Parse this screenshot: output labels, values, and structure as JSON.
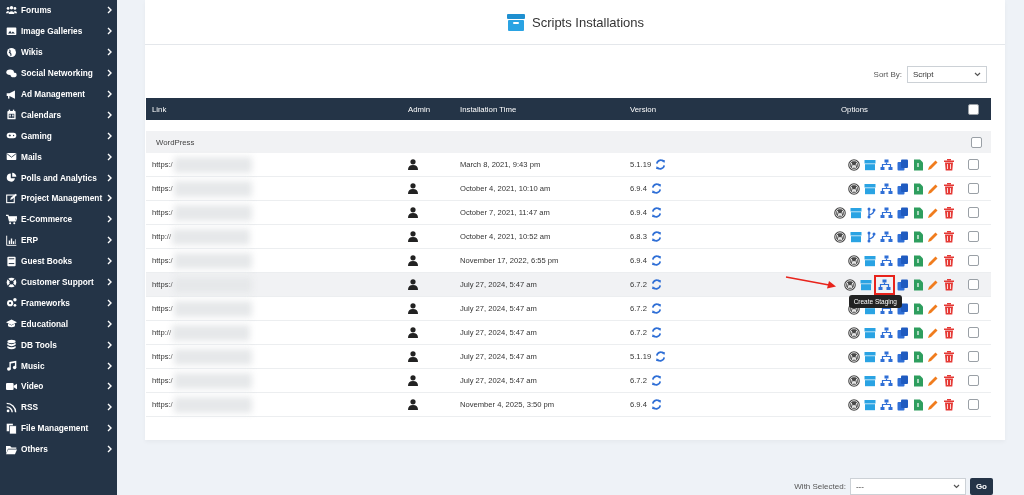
{
  "sidebar": {
    "items": [
      {
        "label": "Forums"
      },
      {
        "label": "Image Galleries"
      },
      {
        "label": "Wikis"
      },
      {
        "label": "Social Networking"
      },
      {
        "label": "Ad Management"
      },
      {
        "label": "Calendars"
      },
      {
        "label": "Gaming"
      },
      {
        "label": "Mails"
      },
      {
        "label": "Polls and Analytics"
      },
      {
        "label": "Project Management"
      },
      {
        "label": "E-Commerce"
      },
      {
        "label": "ERP"
      },
      {
        "label": "Guest Books"
      },
      {
        "label": "Customer Support"
      },
      {
        "label": "Frameworks"
      },
      {
        "label": "Educational"
      },
      {
        "label": "DB Tools"
      },
      {
        "label": "Music"
      },
      {
        "label": "Video"
      },
      {
        "label": "RSS"
      },
      {
        "label": "File Management"
      },
      {
        "label": "Others"
      }
    ]
  },
  "page": {
    "title": "Scripts Installations",
    "sort": {
      "label": "Sort By:",
      "value": "Script"
    }
  },
  "table": {
    "columns": [
      "Link",
      "Admin",
      "Installation Time",
      "Version",
      "Options"
    ],
    "header_checked": false,
    "group": {
      "name": "WordPress",
      "checked": false
    },
    "rows": [
      {
        "link": "https:/",
        "time": "March 8, 2021, 9:43 pm",
        "version": "5.1.19",
        "branch": false,
        "highlighted": false,
        "marked": false,
        "checked": false
      },
      {
        "link": "https:/",
        "time": "October 4, 2021, 10:10 am",
        "version": "6.9.4",
        "branch": false,
        "highlighted": false,
        "marked": false,
        "checked": false
      },
      {
        "link": "https:/",
        "time": "October 7, 2021, 11:47 am",
        "version": "6.9.4",
        "branch": true,
        "highlighted": false,
        "marked": false,
        "checked": false
      },
      {
        "link": "http://",
        "time": "October 4, 2021, 10:52 am",
        "version": "6.8.3",
        "branch": true,
        "highlighted": false,
        "marked": false,
        "checked": false
      },
      {
        "link": "https:/",
        "time": "November 17, 2022, 6:55 pm",
        "version": "6.9.4",
        "branch": false,
        "highlighted": false,
        "marked": false,
        "checked": false
      },
      {
        "link": "https:/",
        "time": "July 27, 2024, 5:47 am",
        "version": "6.7.2",
        "branch": false,
        "highlighted": true,
        "marked": true,
        "tooltip": "Create Staging",
        "checked": false
      },
      {
        "link": "https:/",
        "time": "July 27, 2024, 5:47 am",
        "version": "6.7.2",
        "branch": false,
        "highlighted": false,
        "marked": false,
        "checked": false
      },
      {
        "link": "http://",
        "time": "July 27, 2024, 5:47 am",
        "version": "6.7.2",
        "branch": false,
        "highlighted": false,
        "marked": false,
        "checked": false
      },
      {
        "link": "https:/",
        "time": "July 27, 2024, 5:47 am",
        "version": "5.1.19",
        "branch": false,
        "highlighted": false,
        "marked": false,
        "checked": false
      },
      {
        "link": "https:/",
        "time": "July 27, 2024, 5:47 am",
        "version": "6.7.2",
        "branch": false,
        "highlighted": false,
        "marked": false,
        "checked": false
      },
      {
        "link": "https:/",
        "time": "November 4, 2025, 3:50 pm",
        "version": "6.9.4",
        "branch": false,
        "highlighted": false,
        "marked": false,
        "checked": false
      }
    ]
  },
  "bulk": {
    "label": "With Selected:",
    "value": "---",
    "button": "Go"
  }
}
